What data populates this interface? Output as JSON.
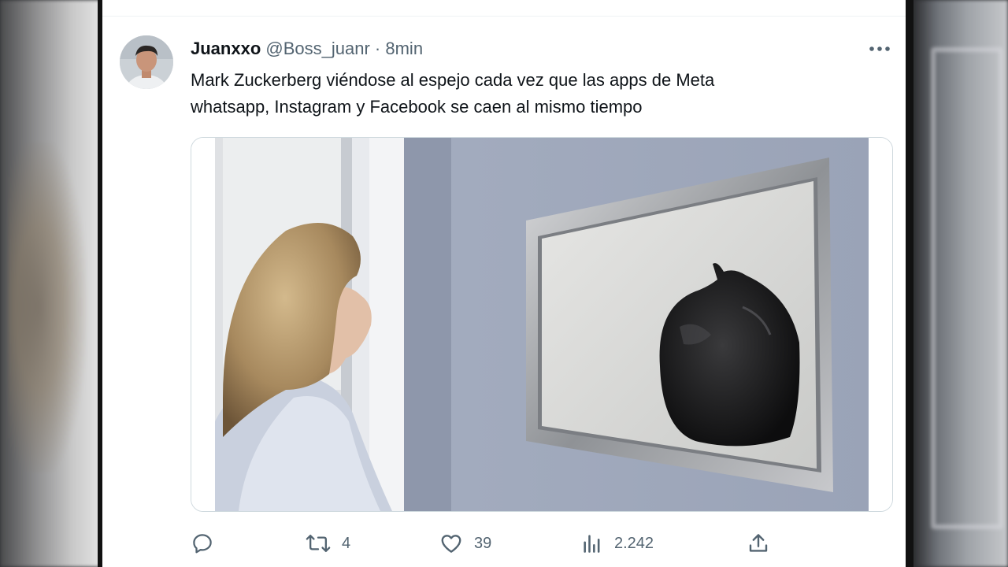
{
  "tweet": {
    "display_name": "Juanxxo",
    "handle": "@Boss_juanr",
    "separator": "·",
    "time": "8min",
    "text_line1": "Mark Zuckerberg viéndose al espejo cada vez que las apps de Meta",
    "text_line2": "whatsapp, Instagram y Facebook se caen al mismo tiempo"
  },
  "actions": {
    "reply": {
      "icon": "reply-icon",
      "count": ""
    },
    "retweet": {
      "icon": "retweet-icon",
      "count": "4"
    },
    "like": {
      "icon": "heart-icon",
      "count": "39"
    },
    "views": {
      "icon": "views-icon",
      "count": "2.242"
    },
    "share": {
      "icon": "share-icon",
      "count": ""
    }
  },
  "colors": {
    "text_primary": "#0f1419",
    "text_secondary": "#536471",
    "border": "#cfd9de",
    "background": "#ffffff"
  }
}
